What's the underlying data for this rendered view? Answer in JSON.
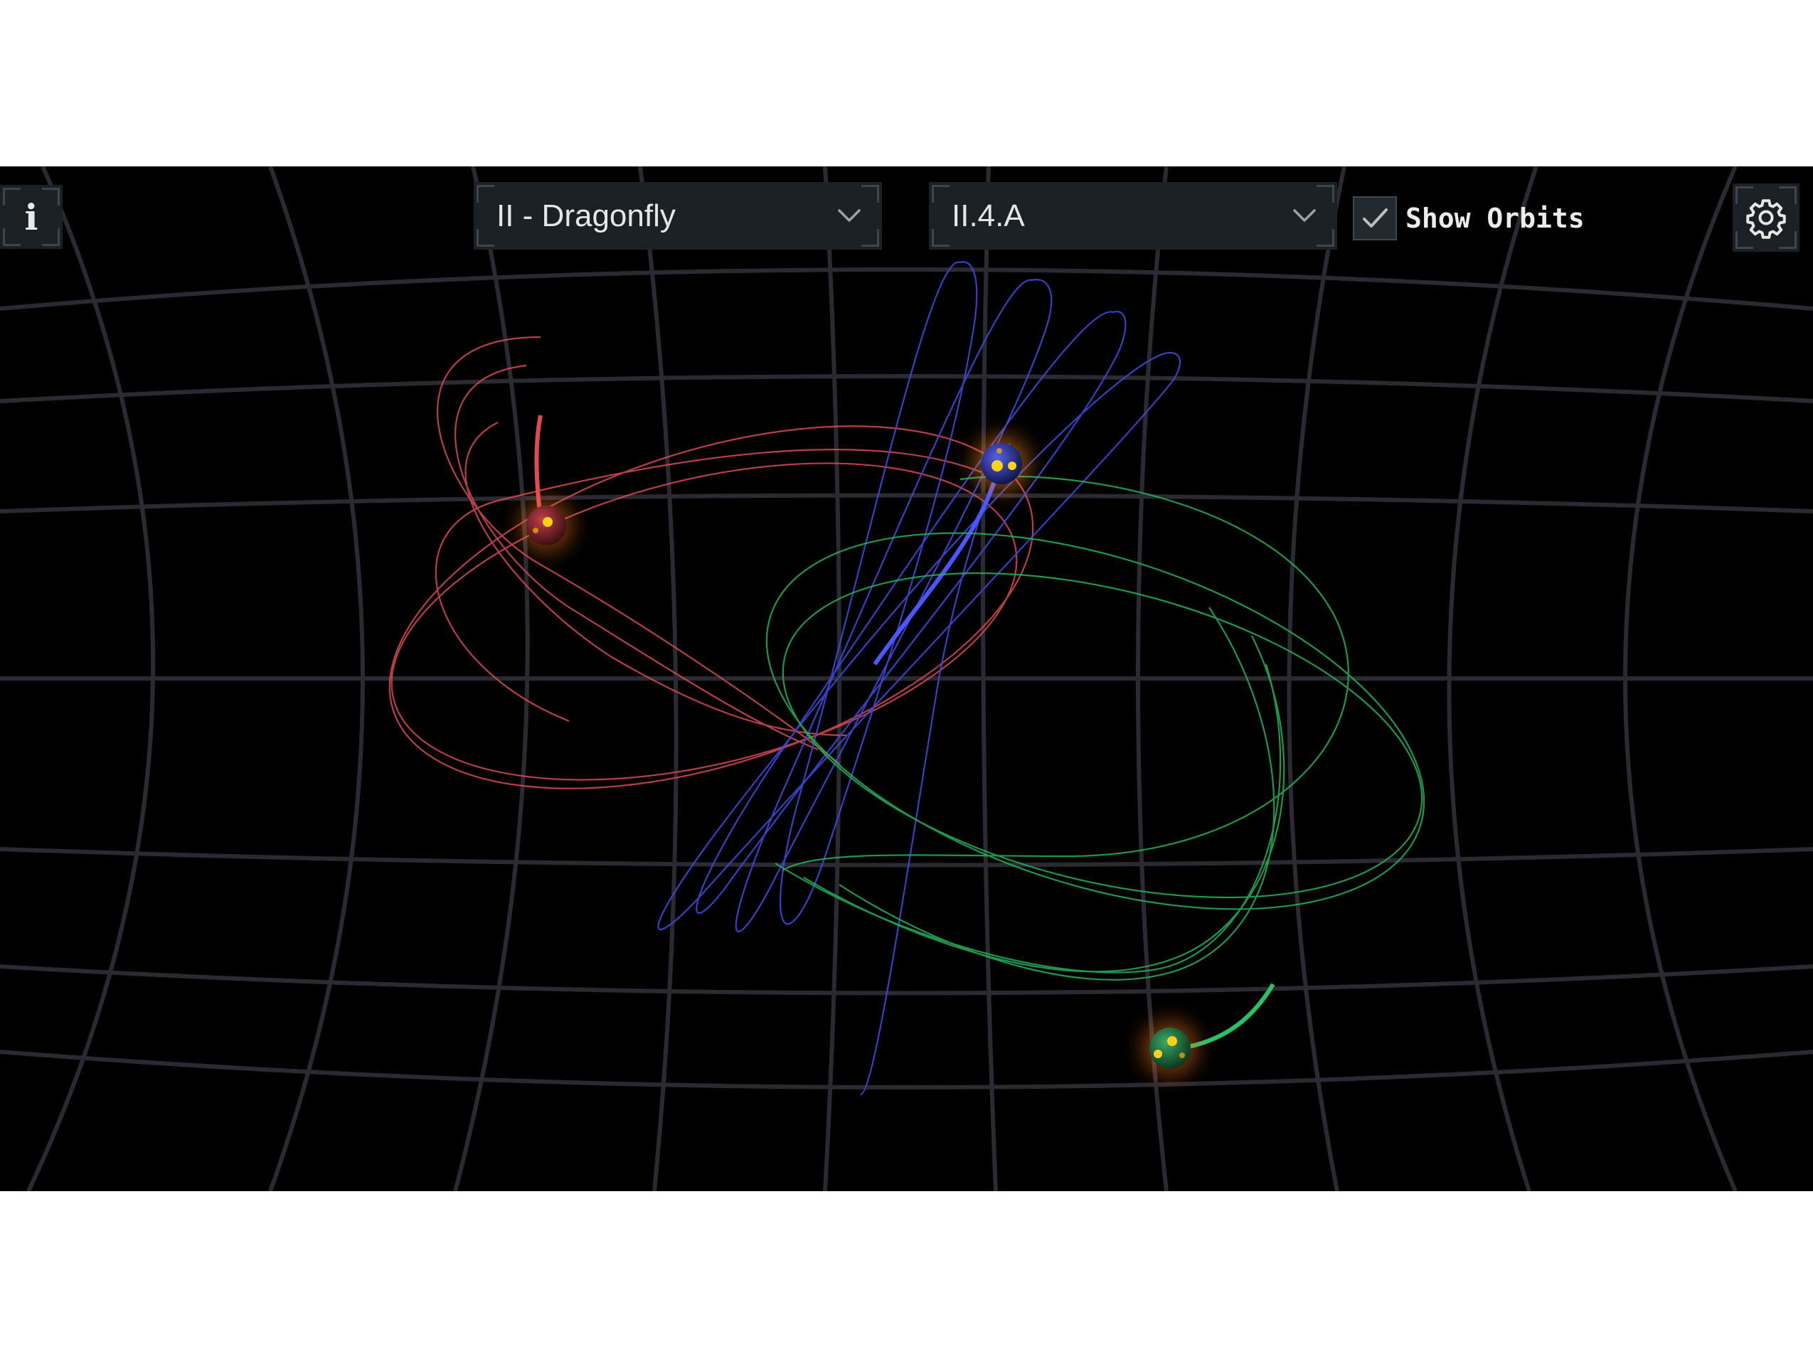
{
  "toolbar": {
    "info_glyph": "i",
    "family_select": {
      "value": "II - Dragonfly"
    },
    "orbit_select": {
      "value": "II.4.A"
    },
    "show_orbits": {
      "label": "Show Orbits",
      "checked": true
    }
  },
  "icons": [
    "info-icon",
    "chevron-down-icon",
    "check-icon",
    "gear-icon"
  ],
  "colors": {
    "background": "#000000",
    "grid": "#2a2a32",
    "body_red": "#d94a55",
    "body_blue": "#3f49d9",
    "body_green": "#23b35a",
    "body_core": "#ffd21a",
    "panel": "#1a2024"
  }
}
